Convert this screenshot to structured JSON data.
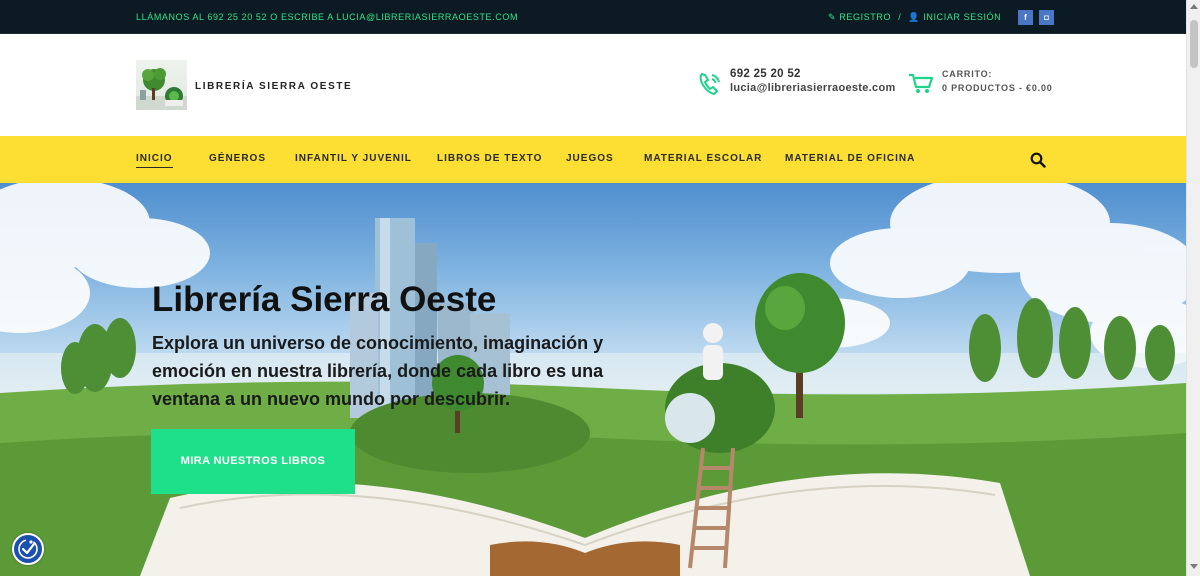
{
  "topbar": {
    "contact": "LLÁMANOS AL 692 25 20 52 O ESCRIBE A LUCIA@LIBRERIASIERRAOESTE.COM",
    "register": "REGISTRO",
    "separator": "/",
    "login": "INICIAR SESIÓN",
    "social": [
      {
        "name": "facebook",
        "glyph": "f"
      },
      {
        "name": "instagram",
        "glyph": "◘"
      }
    ],
    "colors": {
      "background": "#0c1a24",
      "accent": "#2ee58a",
      "social": "#4a76c4"
    }
  },
  "header": {
    "site_name": "LIBRERÍA SIERRA OESTE",
    "phone": "692 25 20 52",
    "email": "lucia@libreriasierraoeste.com",
    "cart_title": "CARRITO:",
    "cart_info": "0 PRODUCTOS - €0.00",
    "icons": [
      "phone-icon",
      "cart-icon",
      "logo"
    ]
  },
  "nav": {
    "items": [
      {
        "label": "INICIO",
        "active": true
      },
      {
        "label": "GÉNEROS"
      },
      {
        "label": "INFANTIL Y JUVENIL"
      },
      {
        "label": "LIBROS DE TEXTO"
      },
      {
        "label": "JUEGOS"
      },
      {
        "label": "MATERIAL ESCOLAR"
      },
      {
        "label": "MATERIAL DE OFICINA"
      }
    ],
    "search_icon": "search-icon",
    "color": "#fddf33"
  },
  "hero": {
    "title": "Librería Sierra Oeste",
    "text": "Explora un universo de conocimiento, imaginación y emoción en nuestra librería, donde cada libro es una ventana a un nuevo mundo por descubrir.",
    "button": "MIRA NUESTROS LIBROS",
    "button_color": "#1fe08a"
  },
  "widgets": {
    "accessibility_icon": "accessibility-icon"
  }
}
